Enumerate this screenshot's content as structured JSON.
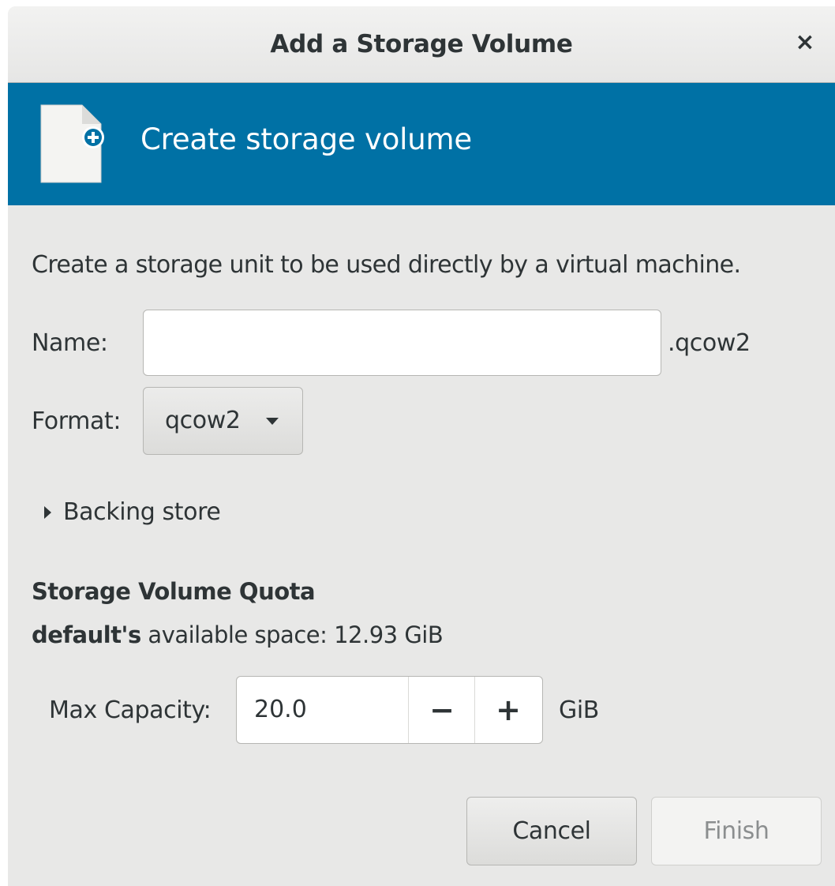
{
  "dialog": {
    "title": "Add a Storage Volume",
    "close_symbol": "×"
  },
  "banner": {
    "title": "Create storage volume",
    "icon": "new-file-icon",
    "color": "#0071a5"
  },
  "description": "Create a storage unit to be used directly by a virtual machine.",
  "name_field": {
    "label": "Name:",
    "value": "",
    "suffix": ".qcow2"
  },
  "format_field": {
    "label": "Format:",
    "selected": "qcow2"
  },
  "backing_store": {
    "label": "Backing store",
    "expanded": false
  },
  "quota": {
    "heading": "Storage Volume Quota",
    "pool_name": "default's",
    "available_text": "available space: 12.93 GiB"
  },
  "capacity": {
    "label": "Max Capacity:",
    "value": "20.0",
    "minus": "−",
    "plus": "+",
    "unit": "GiB"
  },
  "buttons": {
    "cancel": "Cancel",
    "finish": "Finish"
  }
}
